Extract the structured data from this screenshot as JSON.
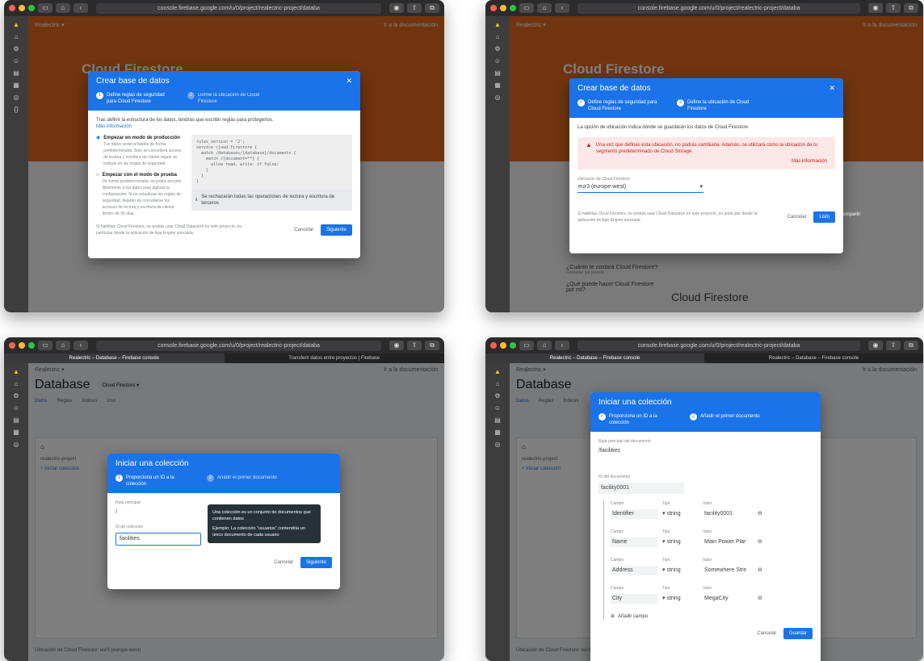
{
  "browser": {
    "url": "console.firebase.google.com/u/0/project/realectric-project/databa",
    "tab_active": "Realectric – Database – Firebase console",
    "tab_other": "Transferir datos entre proyectos | Firebase",
    "tab_other_4": "Realectric – Database – Firebase console"
  },
  "console": {
    "project": "Realectric ▾",
    "docs_link": "Ir a la documentación",
    "hero_title": "Cloud Firestore"
  },
  "panel1": {
    "dialog_title": "Crear base de datos",
    "step1": "Define reglas de seguridad para Cloud Firestore",
    "step2": "Define la ubicación de Cloud Firestore",
    "intro": "Tras definir la estructura de los datos, tendrás que escribir reglas para protegerlos.",
    "more_info": "Más información",
    "opt_prod_title": "Empezar en modo de producción",
    "opt_prod_desc": "Tus datos serán privados de forma predeterminada. Solo se concederá acceso de lectura y escritura de cliente según se indique en las reglas de seguridad.",
    "opt_test_title": "Empezar con el modo de prueba",
    "opt_test_desc": "De forma predeterminada, se podrá acceder libremente a tus datos para agilizar la configuración. Si no actualizas las reglas de seguridad, dejarán de concederse los accesos de lectura y escritura de cliente dentro de 30 días.",
    "code": "rules_version = '2';\nservice cloud.firestore {\n  match /databases/{database}/documents {\n    match /{document=**} {\n      allow read, write: if false;\n    }\n  }\n}",
    "notice": "Se rechazarán todas las operaciones de lectura y escritura de terceros",
    "footnote": "Si habilitas Cloud Firestore, no podrás usar Cloud Datastore en este proyecto, en particular desde la aplicación de App Engine asociada.",
    "cancel": "Cancelar",
    "next": "Siguiente"
  },
  "panel2": {
    "dialog_title": "Crear base de datos",
    "step1": "Define reglas de seguridad para Cloud Firestore",
    "step2": "Define la ubicación de Cloud Firestore",
    "intro": "La opción de ubicación indica dónde se guardarán los datos de Cloud Firestore.",
    "warning": "Una vez que definas esta ubicación, no podrás cambiarla. Además, se utilizará como la ubicación de tu segmento predeterminado de Cloud Storage.",
    "more_info": "Más información",
    "location_label": "Ubicación de Cloud Firestore",
    "location_value": "eur3 (europe-west)",
    "footnote": "Si habilitas Cloud Firestore, no podrás usar Cloud Datastore en este proyecto, en particular desde la aplicación de App Engine asociada.",
    "cancel": "Cancelar",
    "done": "Listo",
    "share": "Compartir",
    "cost_q": "¿Cuánto te costará Cloud Firestore?",
    "cost_link": "Consultar los precios",
    "what_q": "¿Qué puede hacer Cloud Firestore por mí?"
  },
  "panel3": {
    "page_title": "Database",
    "db_selector": "Cloud Firestore ▾",
    "tabs": [
      "Datos",
      "Reglas",
      "Índices",
      "Uso"
    ],
    "project_row": "realectric-project",
    "start_collection": "Iniciar colección",
    "dialog_title": "Iniciar una colección",
    "step1": "Proporciona un ID a la colección",
    "step2": "Añadir el primer documento",
    "parent_path_label": "Ruta principal",
    "parent_path": "/",
    "collection_id_label": "ID de colección",
    "collection_id": "facilities",
    "tip_1": "Una colección es un conjunto de documentos que contienen datos",
    "tip_2": "Ejemplo: La colección \"usuarios\" contendría un único documento de cada usuario",
    "cancel": "Cancelar",
    "next": "Siguiente",
    "location_footer": "Ubicación de Cloud Firestore: eur3 (europe-west)"
  },
  "panel4": {
    "dialog_title": "Iniciar una colección",
    "step1": "Proporciona un ID a la colección",
    "step2": "Añadir el primer documento",
    "parent_label": "Ruta principal del documento",
    "parent_path": "/facilities",
    "doc_id_label": "ID del documento",
    "doc_id": "facility0001",
    "col_field": "Campo",
    "col_type": "Tipo",
    "col_value": "Valor",
    "fields": [
      {
        "name": "Identifier",
        "type": "string",
        "value": "facility0001"
      },
      {
        "name": "Name",
        "type": "string",
        "value": "Main Power Plar"
      },
      {
        "name": "Address",
        "type": "string",
        "value": "Somewhere Stre"
      },
      {
        "name": "City",
        "type": "string",
        "value": "MegaCity"
      }
    ],
    "add_field": "Añadir campo",
    "cancel": "Cancelar",
    "save": "Guardar",
    "location_footer": "Ubicación de Cloud Firestore: eur3"
  }
}
